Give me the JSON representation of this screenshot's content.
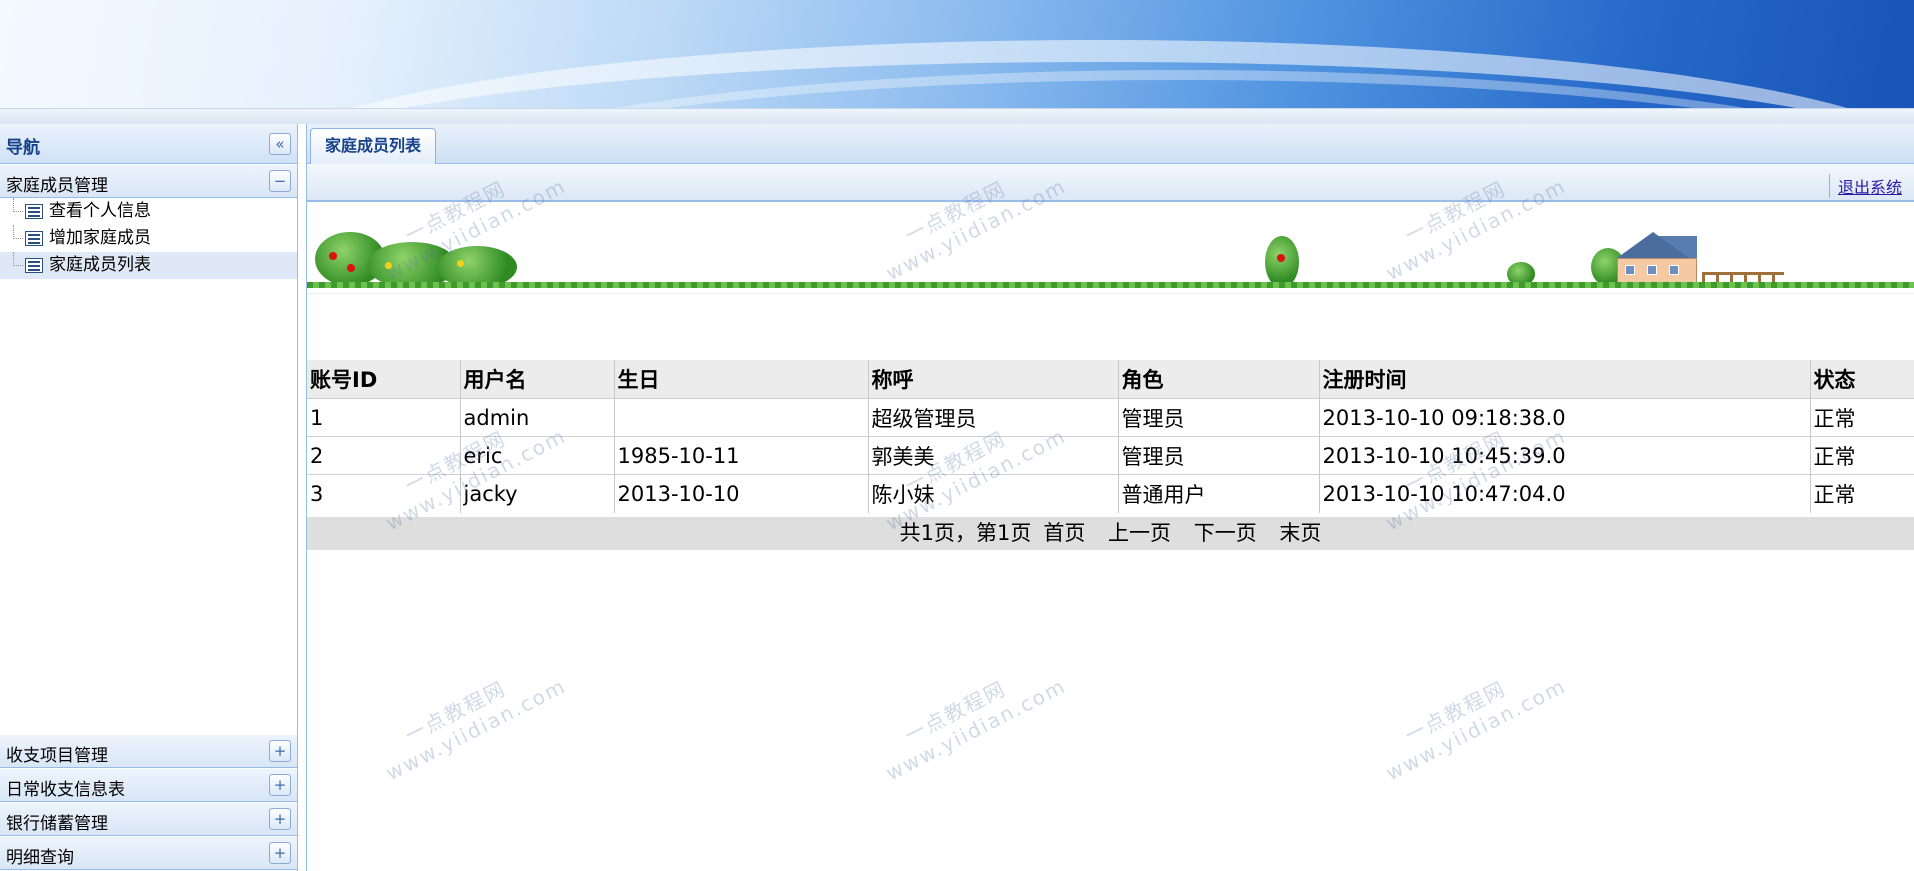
{
  "nav": {
    "title": "导航",
    "collapse_icon": "double-chevron-left-icon",
    "sections": [
      {
        "label": "家庭成员管理",
        "expanded": true,
        "items": [
          {
            "label": "查看个人信息"
          },
          {
            "label": "增加家庭成员"
          },
          {
            "label": "家庭成员列表",
            "selected": true
          }
        ]
      },
      {
        "label": "收支项目管理",
        "expanded": false
      },
      {
        "label": "日常收支信息表",
        "expanded": false
      },
      {
        "label": "银行储蓄管理",
        "expanded": false
      },
      {
        "label": "明细查询",
        "expanded": false
      }
    ]
  },
  "tabs": [
    {
      "label": "家庭成员列表",
      "active": true
    }
  ],
  "toolbar": {
    "logout_label": "退出系统"
  },
  "table": {
    "headers": [
      "账号ID",
      "用户名",
      "生日",
      "称呼",
      "角色",
      "注册时间",
      "状态"
    ],
    "rows": [
      [
        "1",
        "admin",
        "",
        "超级管理员",
        "管理员",
        "2013-10-10 09:18:38.0",
        "正常"
      ],
      [
        "2",
        "eric",
        "1985-10-11",
        "郭美美",
        "管理员",
        "2013-10-10 10:45:39.0",
        "正常"
      ],
      [
        "3",
        "jacky",
        "2013-10-10",
        "陈小妹",
        "普通用户",
        "2013-10-10 10:47:04.0",
        "正常"
      ]
    ]
  },
  "pager": {
    "info": "共1页，第1页",
    "first": "首页",
    "prev": "上一页",
    "next": "下一页",
    "last": "末页"
  },
  "watermark": {
    "cn": "一点教程网",
    "url": "www.yiidian.com"
  },
  "colors": {
    "panel_border": "#99bbe8",
    "panel_title": "#15428b",
    "selected_row": "#dfe8f6"
  }
}
